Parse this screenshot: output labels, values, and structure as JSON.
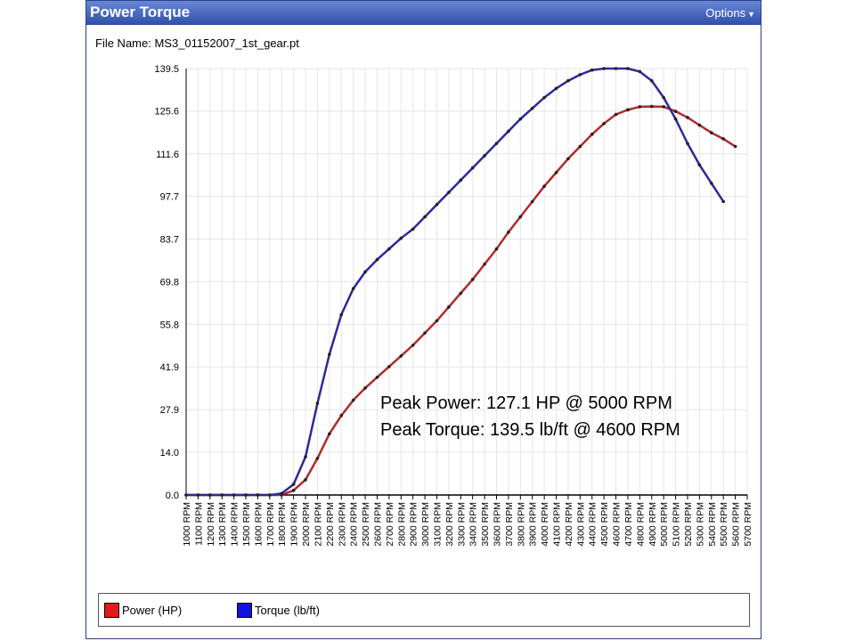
{
  "window": {
    "title": "Power Torque",
    "options_label": "Options",
    "file_name_label": "File Name: MS3_01152007_1st_gear.pt"
  },
  "annotations": {
    "peak_power": "Peak Power: 127.1 HP @ 5000 RPM",
    "peak_torque": "Peak Torque: 139.5 lb/ft @ 4600 RPM"
  },
  "colors": {
    "power": "#b22a2a",
    "torque": "#2b2a9c",
    "power_swatch": "#e11b1b",
    "torque_swatch": "#1010e0",
    "grid": "#e6e6e6"
  },
  "chart_data": {
    "type": "line",
    "title": "",
    "xlabel": "",
    "ylabel": "",
    "ylim": [
      0,
      139.5
    ],
    "yticks": [
      "0.0",
      "14.0",
      "27.9",
      "41.9",
      "55.8",
      "69.8",
      "83.7",
      "97.7",
      "111.6",
      "125.6",
      "139.5"
    ],
    "categories": [
      "1000 RPM",
      "1100 RPM",
      "1200 RPM",
      "1300 RPM",
      "1400 RPM",
      "1500 RPM",
      "1600 RPM",
      "1700 RPM",
      "1800 RPM",
      "1900 RPM",
      "2000 RPM",
      "2100 RPM",
      "2200 RPM",
      "2300 RPM",
      "2400 RPM",
      "2500 RPM",
      "2600 RPM",
      "2700 RPM",
      "2800 RPM",
      "2900 RPM",
      "3000 RPM",
      "3100 RPM",
      "3200 RPM",
      "3300 RPM",
      "3400 RPM",
      "3500 RPM",
      "3600 RPM",
      "3700 RPM",
      "3800 RPM",
      "3900 RPM",
      "4000 RPM",
      "4100 RPM",
      "4200 RPM",
      "4300 RPM",
      "4400 RPM",
      "4500 RPM",
      "4600 RPM",
      "4700 RPM",
      "4800 RPM",
      "4900 RPM",
      "5000 RPM",
      "5100 RPM",
      "5200 RPM",
      "5300 RPM",
      "5400 RPM",
      "5500 RPM",
      "5600 RPM",
      "5700 RPM"
    ],
    "grid": true,
    "legend_position": "bottom",
    "series": [
      {
        "name": "Power (HP)",
        "values": [
          0,
          0,
          0,
          0,
          0,
          0,
          0,
          0,
          0,
          1.5,
          5,
          12,
          20,
          26,
          31,
          35,
          38.5,
          42,
          45.5,
          49,
          53,
          57,
          61.5,
          66,
          70.5,
          75.5,
          80.5,
          86,
          91,
          96,
          101,
          105.5,
          110,
          114,
          118,
          121.5,
          124.5,
          126,
          127,
          127.1,
          127,
          125.5,
          123.5,
          121,
          118.5,
          116.5,
          114
        ]
      },
      {
        "name": "Torque (lb/ft)",
        "values": [
          0,
          0,
          0,
          0,
          0,
          0,
          0,
          0,
          0.5,
          3.5,
          12.5,
          30,
          46,
          59,
          67.5,
          73,
          77,
          80.5,
          84,
          87,
          91,
          95,
          99,
          103,
          107,
          111,
          115,
          119,
          123,
          126.5,
          130,
          133,
          135.5,
          137.5,
          139,
          139.5,
          139.5,
          139.5,
          138.5,
          135.5,
          130,
          123,
          115,
          108,
          102,
          96
        ]
      }
    ]
  },
  "legend": {
    "power_label": "Power (HP)",
    "torque_label": "Torque (lb/ft)"
  }
}
